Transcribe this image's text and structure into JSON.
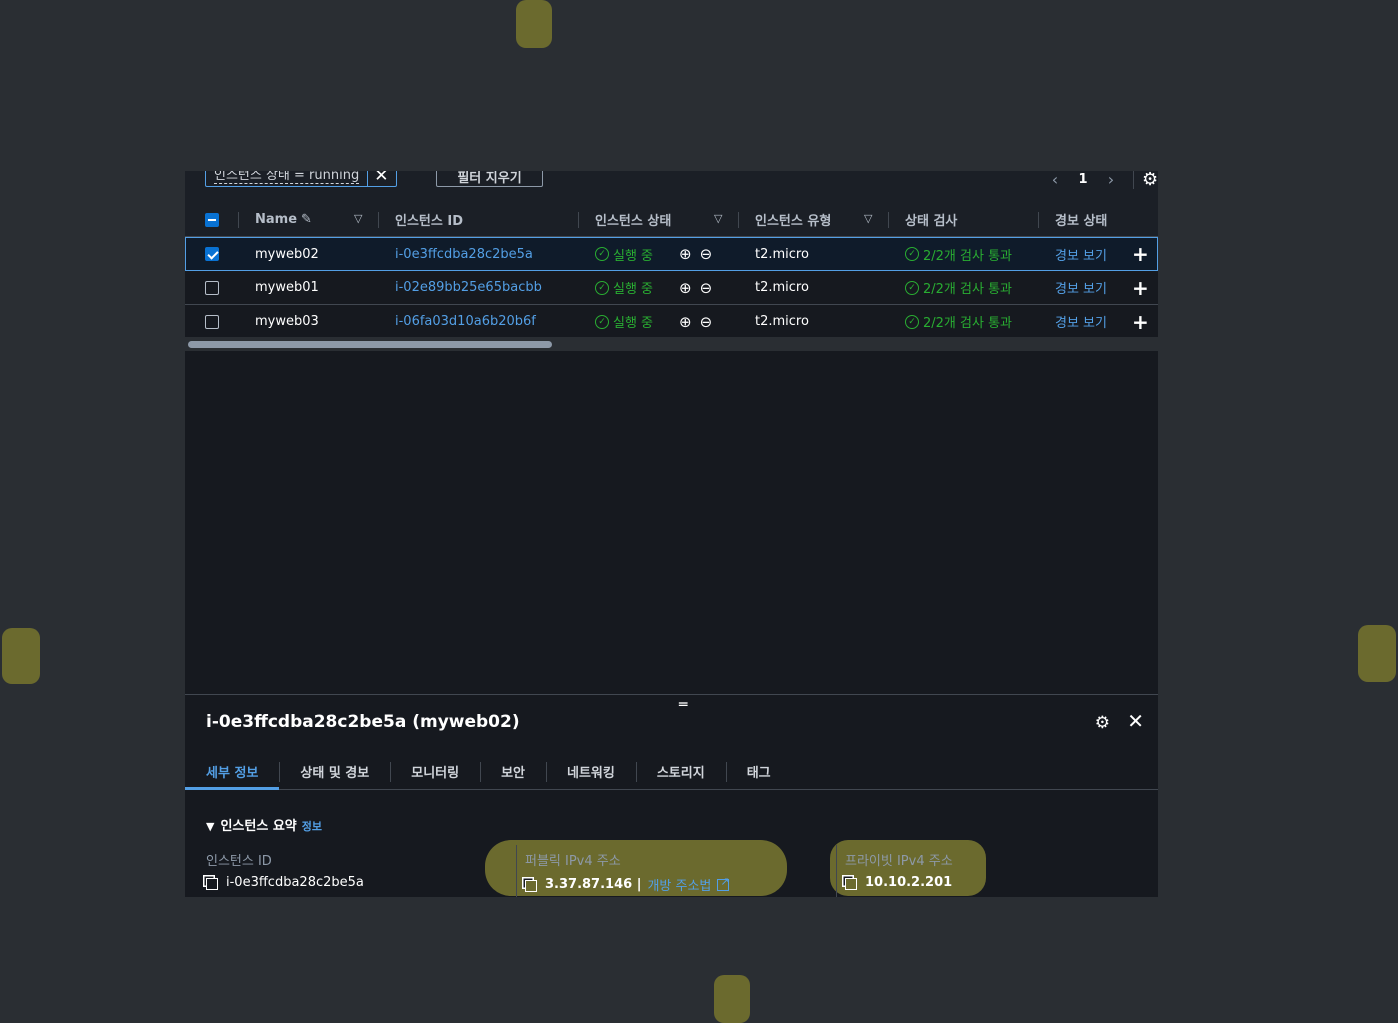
{
  "toolbar": {
    "filter_text": "인스턴스 상태 = running",
    "clear_label": "필터 지우기",
    "page": "1"
  },
  "table": {
    "headers": {
      "name": "Name",
      "instance_id": "인스턴스 ID",
      "state": "인스턴스 상태",
      "type": "인스턴스 유형",
      "check": "상태 검사",
      "alarm": "경보 상태"
    },
    "rows": [
      {
        "name": "myweb02",
        "id": "i-0e3ffcdba28c2be5a",
        "state": "실행 중",
        "type": "t2.micro",
        "check": "2/2개 검사 통과",
        "alarm": "경보 보기",
        "selected": true
      },
      {
        "name": "myweb01",
        "id": "i-02e89bb25e65bacbb",
        "state": "실행 중",
        "type": "t2.micro",
        "check": "2/2개 검사 통과",
        "alarm": "경보 보기",
        "selected": false
      },
      {
        "name": "myweb03",
        "id": "i-06fa03d10a6b20b6f",
        "state": "실행 중",
        "type": "t2.micro",
        "check": "2/2개 검사 통과",
        "alarm": "경보 보기",
        "selected": false
      }
    ]
  },
  "panel": {
    "title": "i-0e3ffcdba28c2be5a (myweb02)",
    "tabs": [
      "세부 정보",
      "상태 및 경보",
      "모니터링",
      "보안",
      "네트워킹",
      "스토리지",
      "태그"
    ],
    "summary_title": "인스턴스 요약",
    "summary_info": "정보",
    "fields": {
      "id_label": "인스턴스 ID",
      "id_value": "i-0e3ffcdba28c2be5a",
      "public_label": "퍼블릭 IPv4 주소",
      "public_value": "3.37.87.146 |",
      "public_link": "개방 주소법",
      "private_label": "프라이빗 IPv4 주소",
      "private_value": "10.10.2.201"
    }
  },
  "colors": {
    "background": "#2a2e33",
    "panel": "#16191f",
    "link": "#539fe5",
    "success": "#29ad32",
    "highlight": "#6b6a2e"
  },
  "icons": [
    "close-icon",
    "chevron-left-icon",
    "chevron-right-icon",
    "gear-icon",
    "edit-icon",
    "sort-down-icon",
    "check-circle-icon",
    "zoom-in-icon",
    "zoom-out-icon",
    "plus-icon",
    "drag-handle-icon",
    "copy-icon",
    "external-link-icon",
    "caret-down-icon"
  ]
}
